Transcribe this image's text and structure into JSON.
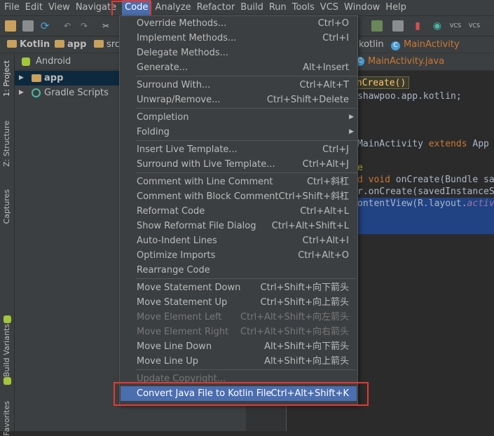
{
  "menubar": {
    "items": [
      "File",
      "Edit",
      "View",
      "Navigate",
      "Code",
      "Analyze",
      "Refactor",
      "Build",
      "Run",
      "Tools",
      "VCS",
      "Window",
      "Help"
    ],
    "active": "Code"
  },
  "toolbar": {
    "vcs_labels": [
      "VCS",
      "VCS"
    ]
  },
  "navbar": {
    "crumbs": [
      "Kotlin",
      "app",
      "src"
    ],
    "right_crumbs": [
      "kotlin",
      "MainActivity"
    ]
  },
  "project_panel": {
    "view": "Android",
    "tree": [
      {
        "label": "app",
        "selected": true
      },
      {
        "label": "Gradle Scripts",
        "selected": false
      }
    ]
  },
  "left_strip": {
    "tabs": [
      "1: Project",
      "Z: Structure",
      "Captures",
      "Build Variants",
      "Favorites"
    ]
  },
  "editor": {
    "tab_label": "MainActivity.java",
    "breadcrumb": "onCreate()",
    "lines": {
      "l1": "shawpoo.app.kotlin;",
      "l2_pre": "MainActivity ",
      "l2_kw": "extends",
      "l2_post": " App",
      "l3": "e",
      "l4_kw": "d void",
      "l4_post": " onCreate(Bundle sa",
      "l5_pre": "r.onCreate(savedInstanceS",
      "l6_pre": "ontentView(R.layout.",
      "l6_it": "activ"
    }
  },
  "dropdown": {
    "items": [
      {
        "label": "Override Methods...",
        "shortcut": "Ctrl+O",
        "disabled": false,
        "submenu": false
      },
      {
        "label": "Implement Methods...",
        "shortcut": "Ctrl+I",
        "disabled": false,
        "submenu": false
      },
      {
        "label": "Delegate Methods...",
        "shortcut": "",
        "disabled": false,
        "submenu": false
      },
      {
        "label": "Generate...",
        "shortcut": "Alt+Insert",
        "disabled": false,
        "submenu": false
      },
      {
        "label": "Surround With...",
        "shortcut": "Ctrl+Alt+T",
        "disabled": false,
        "submenu": false
      },
      {
        "label": "Unwrap/Remove...",
        "shortcut": "Ctrl+Shift+Delete",
        "disabled": false,
        "submenu": false
      },
      {
        "label": "Completion",
        "shortcut": "",
        "disabled": false,
        "submenu": true
      },
      {
        "label": "Folding",
        "shortcut": "",
        "disabled": false,
        "submenu": true
      },
      {
        "label": "Insert Live Template...",
        "shortcut": "Ctrl+J",
        "disabled": false,
        "submenu": false
      },
      {
        "label": "Surround with Live Template...",
        "shortcut": "Ctrl+Alt+J",
        "disabled": false,
        "submenu": false
      },
      {
        "label": "Comment with Line Comment",
        "shortcut": "Ctrl+斜杠",
        "disabled": false,
        "submenu": false
      },
      {
        "label": "Comment with Block Comment",
        "shortcut": "Ctrl+Shift+斜杠",
        "disabled": false,
        "submenu": false
      },
      {
        "label": "Reformat Code",
        "shortcut": "Ctrl+Alt+L",
        "disabled": false,
        "submenu": false
      },
      {
        "label": "Show Reformat File Dialog",
        "shortcut": "Ctrl+Alt+Shift+L",
        "disabled": false,
        "submenu": false
      },
      {
        "label": "Auto-Indent Lines",
        "shortcut": "Ctrl+Alt+I",
        "disabled": false,
        "submenu": false
      },
      {
        "label": "Optimize Imports",
        "shortcut": "Ctrl+Alt+O",
        "disabled": false,
        "submenu": false
      },
      {
        "label": "Rearrange Code",
        "shortcut": "",
        "disabled": false,
        "submenu": false
      },
      {
        "label": "Move Statement Down",
        "shortcut": "Ctrl+Shift+向下箭头",
        "disabled": false,
        "submenu": false
      },
      {
        "label": "Move Statement Up",
        "shortcut": "Ctrl+Shift+向上箭头",
        "disabled": false,
        "submenu": false
      },
      {
        "label": "Move Element Left",
        "shortcut": "Ctrl+Alt+Shift+向左箭头",
        "disabled": true,
        "submenu": false
      },
      {
        "label": "Move Element Right",
        "shortcut": "Ctrl+Alt+Shift+向右箭头",
        "disabled": true,
        "submenu": false
      },
      {
        "label": "Move Line Down",
        "shortcut": "Alt+Shift+向下箭头",
        "disabled": false,
        "submenu": false
      },
      {
        "label": "Move Line Up",
        "shortcut": "Alt+Shift+向上箭头",
        "disabled": false,
        "submenu": false
      },
      {
        "label": "Update Copyright...",
        "shortcut": "",
        "disabled": true,
        "submenu": false
      },
      {
        "label": "Convert Java File to Kotlin File",
        "shortcut": "Ctrl+Alt+Shift+K",
        "disabled": false,
        "submenu": false,
        "highlighted": true
      }
    ]
  },
  "colors": {
    "menu_bg": "#3c3f41",
    "editor_bg": "#2b2b2b",
    "highlight": "#4b6eaf",
    "annotation_box": "#e53935",
    "keyword": "#cc7832"
  }
}
